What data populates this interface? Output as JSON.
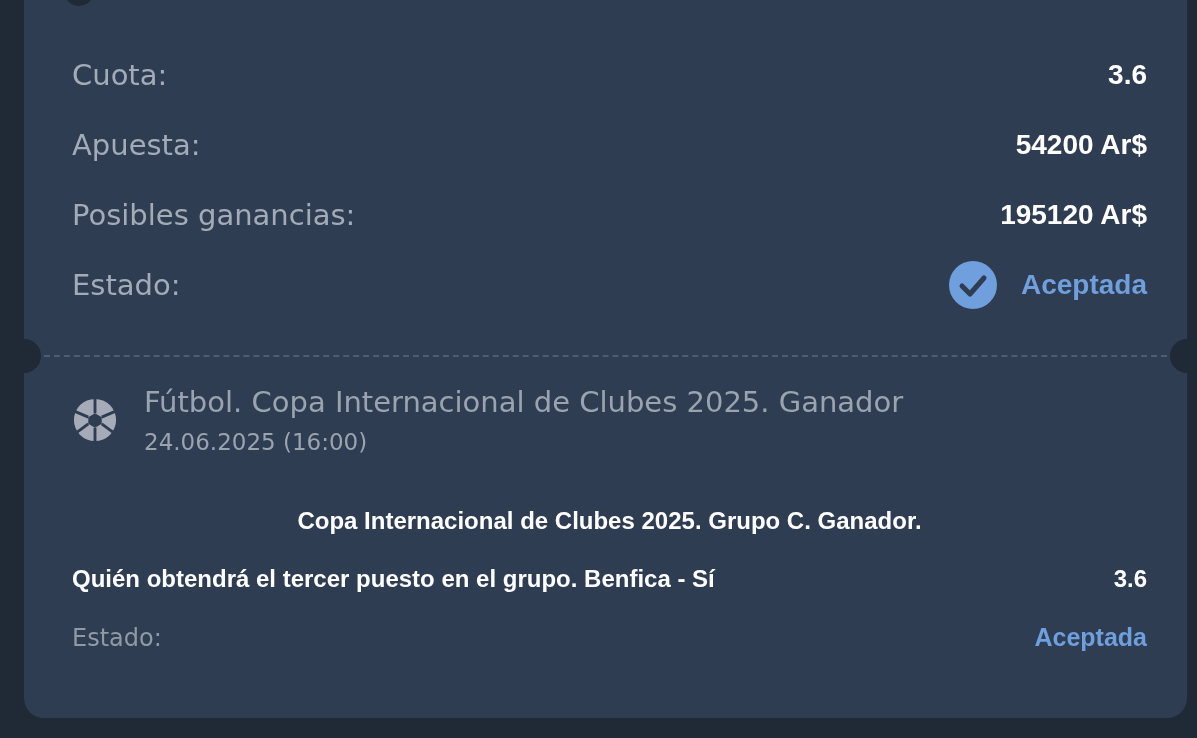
{
  "summary": [
    {
      "label": "Cuota:",
      "value": "3.6"
    },
    {
      "label": "Apuesta:",
      "value": "54200 Ar$"
    },
    {
      "label": "Posibles ganancias:",
      "value": "195120 Ar$"
    }
  ],
  "status": {
    "label": "Estado:",
    "value": "Aceptada",
    "kind": "accepted"
  },
  "event": {
    "title": "Fútbol. Copa Internacional de Clubes 2025. Ganador",
    "date": "24.06.2025 (16:00)"
  },
  "market": "Copa Internacional de Clubes 2025. Grupo C. Ganador.",
  "selection": {
    "name": "Quién obtendrá el tercer puesto en el grupo. Benfica - Sí",
    "odds": "3.6"
  },
  "selection_status": {
    "label": "Estado:",
    "value": "Aceptada",
    "kind": "accepted"
  }
}
